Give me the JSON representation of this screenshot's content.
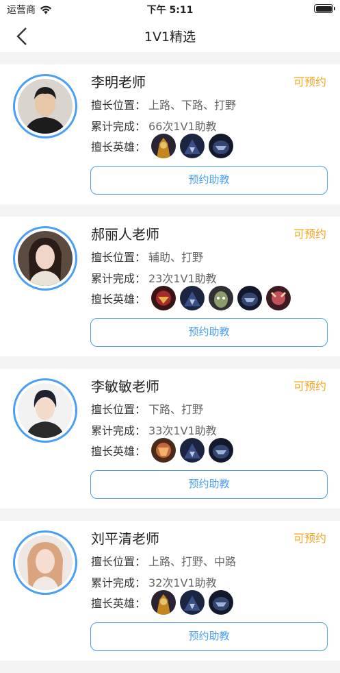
{
  "statusbar": {
    "carrier": "运营商",
    "time": "下午 5:11"
  },
  "nav": {
    "title": "1V1精选",
    "back_icon": "chevron-left-icon"
  },
  "colors": {
    "accent": "#4a9ff5",
    "available": "#f5a623"
  },
  "labels": {
    "position": "擅长位置：",
    "completed": "累计完成：",
    "heroes": "擅长英雄："
  },
  "teachers": [
    {
      "name": "李明老师",
      "status": "可预约",
      "positions": "上路、下路、打野",
      "completed": "66次1V1助教",
      "heroes": [
        "hero-1",
        "hero-2",
        "hero-3"
      ],
      "book": "预约助教"
    },
    {
      "name": "郝丽人老师",
      "status": "可预约",
      "positions": "辅助、打野",
      "completed": "23次1V1助教",
      "heroes": [
        "hero-4",
        "hero-2",
        "hero-5",
        "hero-3",
        "hero-6"
      ],
      "book": "预约助教"
    },
    {
      "name": "李敏敏老师",
      "status": "可预约",
      "positions": "下路、打野",
      "completed": "33次1V1助教",
      "heroes": [
        "hero-7",
        "hero-2",
        "hero-3"
      ],
      "book": "预约助教"
    },
    {
      "name": "刘平清老师",
      "status": "可预约",
      "positions": "上路、打野、中路",
      "completed": "32次1V1助教",
      "heroes": [
        "hero-1",
        "hero-2",
        "hero-3"
      ],
      "book": "预约助教"
    }
  ]
}
